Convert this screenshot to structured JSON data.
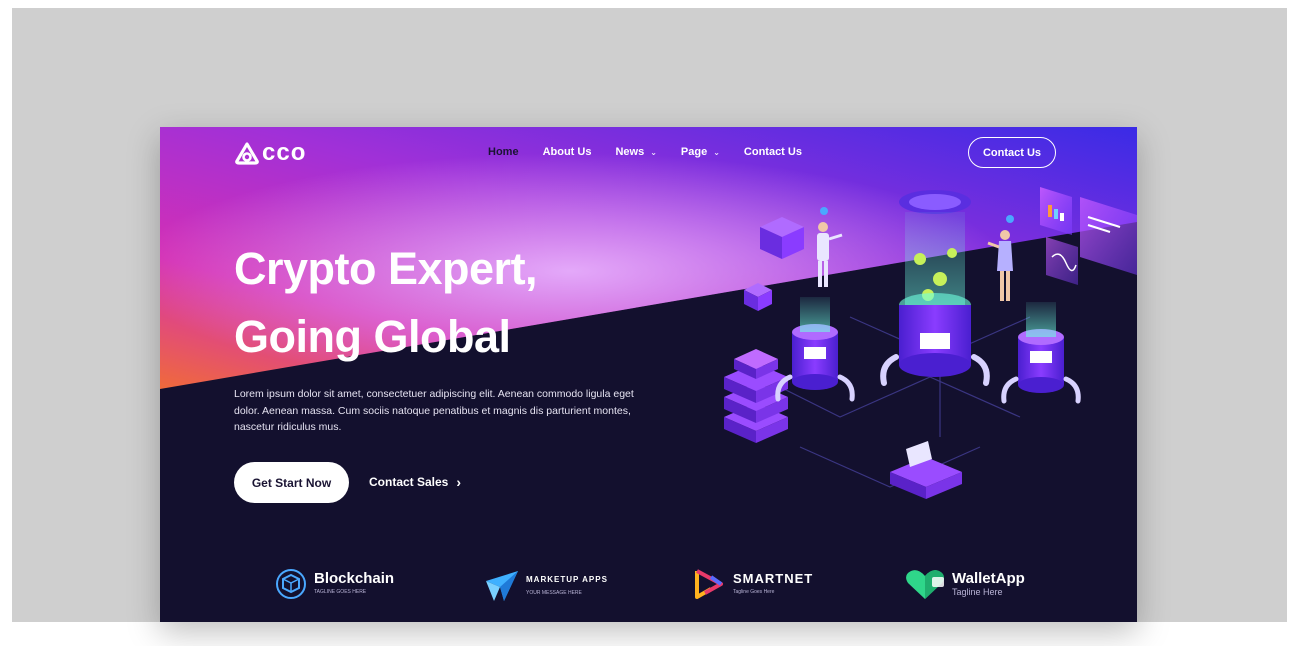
{
  "brand": {
    "name": "cco"
  },
  "nav": {
    "items": [
      {
        "label": "Home",
        "active": true,
        "dropdown": false
      },
      {
        "label": "About Us",
        "active": false,
        "dropdown": false
      },
      {
        "label": "News",
        "active": false,
        "dropdown": true
      },
      {
        "label": "Page",
        "active": false,
        "dropdown": true
      },
      {
        "label": "Contact Us",
        "active": false,
        "dropdown": false
      }
    ],
    "cta_label": "Contact Us"
  },
  "hero": {
    "title_line1": "Crypto Expert,",
    "title_line2": "Going Global",
    "description": "Lorem ipsum dolor sit amet, consectetuer adipiscing elit. Aenean commodo ligula eget dolor. Aenean massa. Cum sociis natoque penatibus et magnis dis parturient montes, nascetur ridiculus mus.",
    "primary_button": "Get Start Now",
    "secondary_button": "Contact Sales",
    "secondary_icon": "chevron-right-icon"
  },
  "partners": [
    {
      "name": "Blockchain",
      "tagline": "TAGLINE GOES HERE",
      "icon": "blockchain-cube-icon"
    },
    {
      "name": "MARKETUP APPS",
      "tagline": "YOUR MESSAGE HERE",
      "icon": "paper-plane-icon"
    },
    {
      "name": "SMARTNET",
      "tagline": "Tagline Goes Here",
      "icon": "smartnet-logo-icon"
    },
    {
      "name": "WalletApp",
      "tagline": "Tagline Here",
      "icon": "wallet-heart-icon"
    }
  ],
  "colors": {
    "background_dark": "#13102e",
    "gradient_magenta": "#d42fb4",
    "gradient_purple": "#6a1fe6",
    "gradient_orange": "#f06a3a",
    "accent_violet": "#7b3cff",
    "page_backdrop": "#cfcfcf"
  }
}
